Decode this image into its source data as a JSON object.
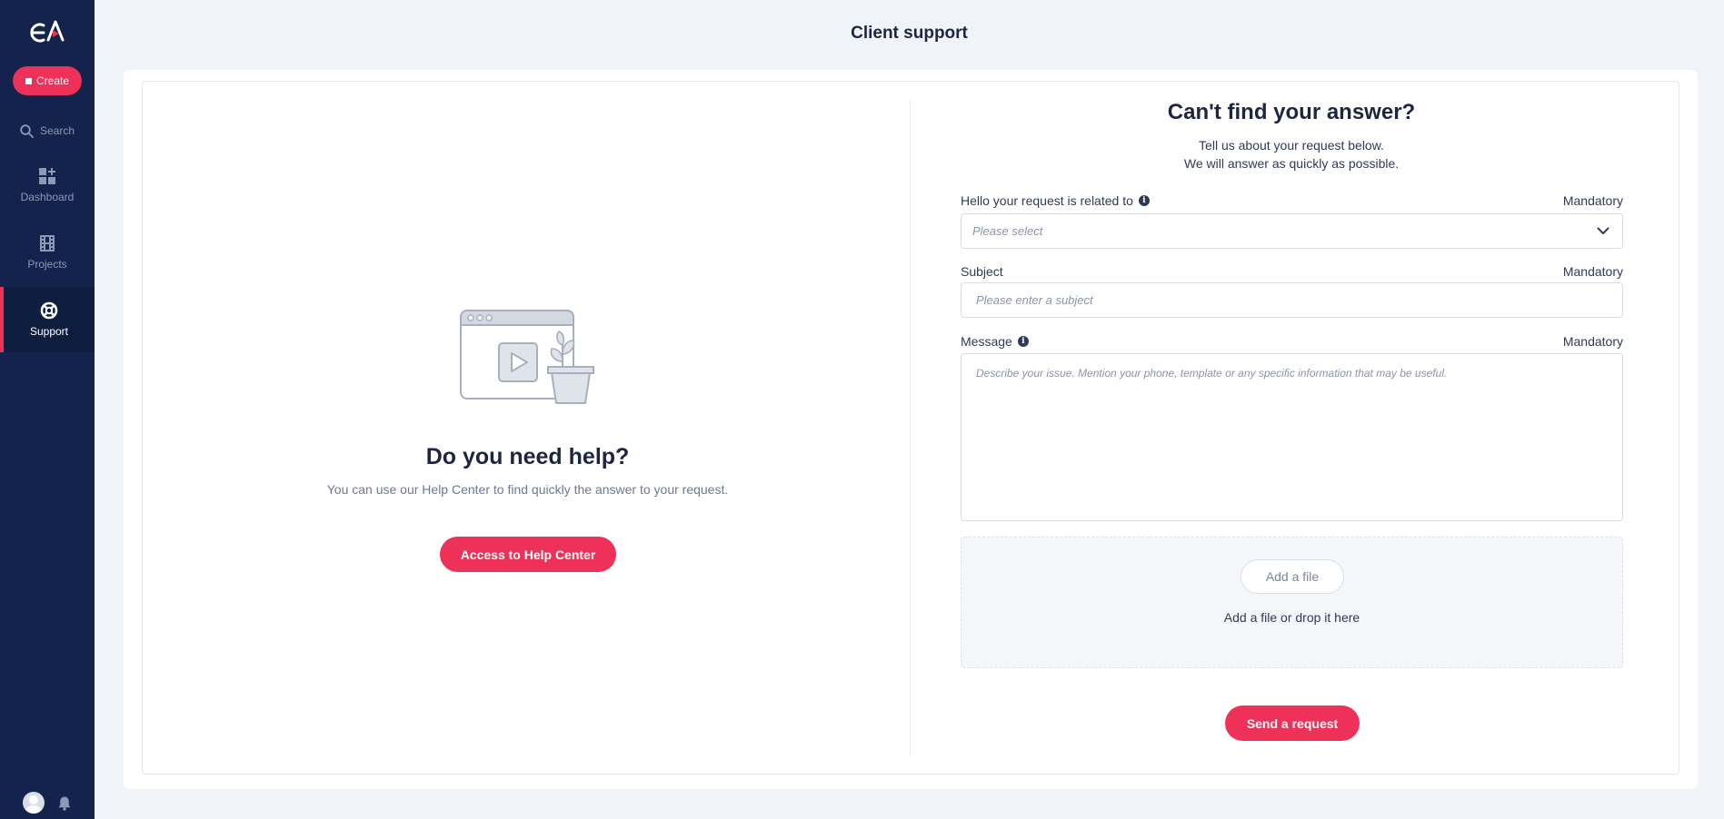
{
  "sidebar": {
    "logo_icon": "ea-logo",
    "create_label": "Create",
    "search_label": "Search",
    "items": [
      {
        "label": "Dashboard",
        "icon": "dashboard-icon"
      },
      {
        "label": "Projects",
        "icon": "film-icon"
      },
      {
        "label": "Support",
        "icon": "lifebuoy-icon",
        "active": true
      }
    ],
    "bottom_icons": [
      "avatar",
      "bell-icon"
    ]
  },
  "page": {
    "title": "Client support"
  },
  "help": {
    "title": "Do you need help?",
    "subtitle": "You can use our Help Center to find quickly the answer to your request.",
    "button_label": "Access to Help Center"
  },
  "form": {
    "title": "Can't find your answer?",
    "subtitle_line1": "Tell us about your request below.",
    "subtitle_line2": "We will answer as quickly as possible.",
    "related": {
      "label": "Hello your request is related to",
      "mandatory": "Mandatory",
      "placeholder": "Please select"
    },
    "subject": {
      "label": "Subject",
      "mandatory": "Mandatory",
      "placeholder": "Please enter a subject"
    },
    "message": {
      "label": "Message",
      "mandatory": "Mandatory",
      "placeholder": "Describe your issue. Mention your phone, template or any specific information that may be useful."
    },
    "file": {
      "button_label": "Add a file",
      "drop_text": "Add a file or drop it here"
    },
    "send_label": "Send a request"
  },
  "colors": {
    "sidebar_bg": "#13234d",
    "accent": "#ee3158",
    "page_bg": "#f0f3f8"
  }
}
